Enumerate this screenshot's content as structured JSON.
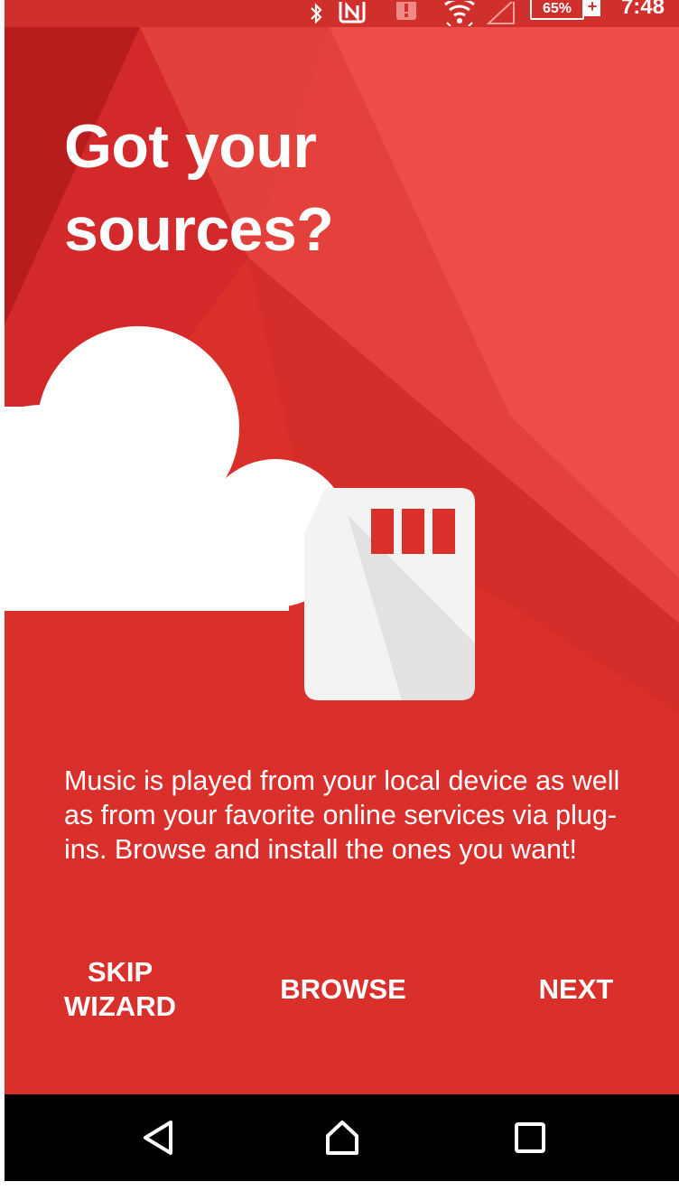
{
  "status_bar": {
    "icons": [
      "bluetooth-icon",
      "nfc-icon",
      "alert-icon",
      "wifi-icon",
      "signal-icon"
    ],
    "battery": "65%",
    "time": "7:48"
  },
  "wizard": {
    "title_line1": "Got your",
    "title_line2": "sources?",
    "illustration": [
      "cloud-icon",
      "sd-card-icon"
    ],
    "description": "Music is played from your local device as well as from your favorite online services via plug-ins. Browse and install the ones you want!",
    "skip_line1": "SKIP",
    "skip_line2": "WIZARD",
    "browse": "BROWSE",
    "next": "NEXT"
  },
  "nav_bar": {
    "icons": [
      "back-icon",
      "home-icon",
      "recents-icon"
    ]
  },
  "colors": {
    "primary_red": "#da302c",
    "dark_red": "#b81d1d",
    "light_red": "#ea4a45",
    "white": "#ffffff",
    "nav_black": "#000000"
  }
}
